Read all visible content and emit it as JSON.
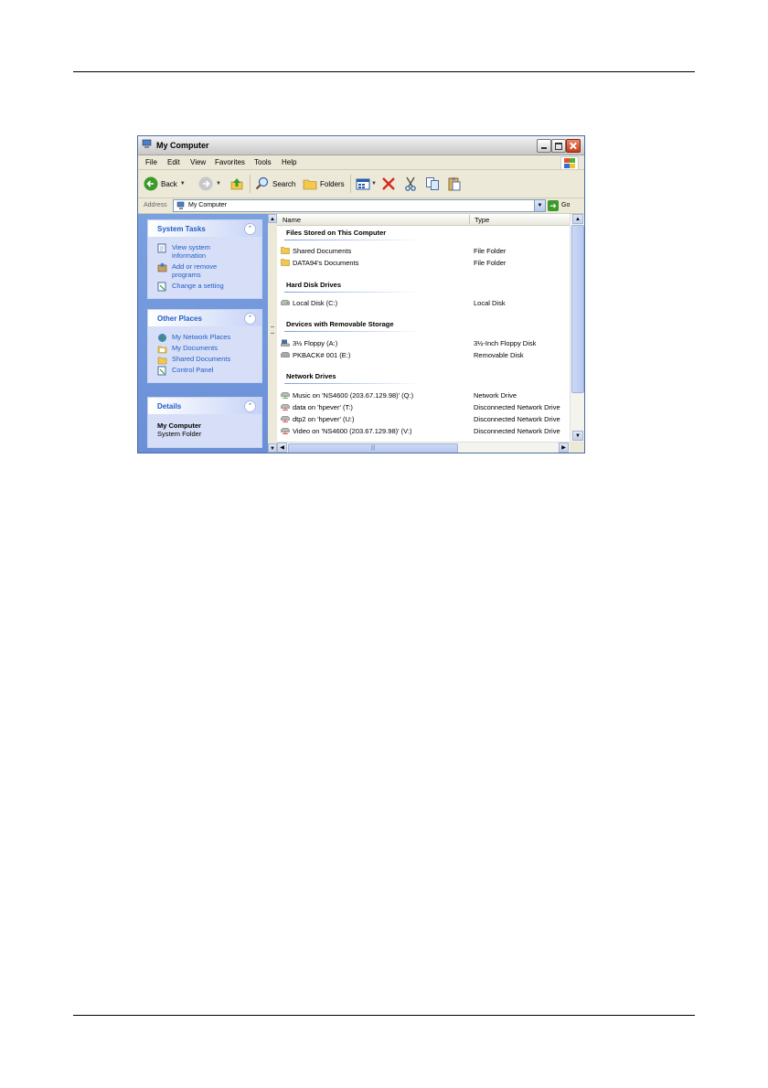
{
  "window": {
    "title": "My Computer",
    "menu": [
      "File",
      "Edit",
      "View",
      "Favorites",
      "Tools",
      "Help"
    ],
    "toolbar": {
      "back_label": "Back",
      "search_label": "Search",
      "folders_label": "Folders"
    },
    "address": {
      "label": "Address",
      "value": "My Computer",
      "go_label": "Go"
    }
  },
  "left_pane": {
    "system_tasks": {
      "title": "System Tasks",
      "items": [
        "View system information",
        "Add or remove programs",
        "Change a setting"
      ]
    },
    "other_places": {
      "title": "Other Places",
      "items": [
        "My Network Places",
        "My Documents",
        "Shared Documents",
        "Control Panel"
      ]
    },
    "details": {
      "title": "Details",
      "name": "My Computer",
      "type": "System Folder"
    }
  },
  "file_list": {
    "columns": {
      "name": "Name",
      "type": "Type"
    },
    "groups": [
      {
        "title": "Files Stored on This Computer",
        "rows": [
          {
            "name": "Shared Documents",
            "type": "File Folder"
          },
          {
            "name": "DATA94's Documents",
            "type": "File Folder"
          }
        ]
      },
      {
        "title": "Hard Disk Drives",
        "rows": [
          {
            "name": "Local Disk (C:)",
            "type": "Local Disk"
          }
        ]
      },
      {
        "title": "Devices with Removable Storage",
        "rows": [
          {
            "name": "3½ Floppy (A:)",
            "type": "3½-Inch Floppy Disk"
          },
          {
            "name": "PKBACK# 001 (E:)",
            "type": "Removable Disk"
          }
        ]
      },
      {
        "title": "Network Drives",
        "rows": [
          {
            "name": "Music on 'NS4600 (203.67.129.98)' (Q:)",
            "type": "Network Drive"
          },
          {
            "name": "data on 'hpever' (T:)",
            "type": "Disconnected Network Drive"
          },
          {
            "name": "dtp2 on 'hpever' (U:)",
            "type": "Disconnected Network Drive"
          },
          {
            "name": "Video on 'NS4600 (203.67.129.98)' (V:)",
            "type": "Disconnected Network Drive"
          }
        ]
      }
    ]
  },
  "colors": {
    "xp_blue": "#215dc6",
    "pane_blue": "#7aa0e0",
    "folder_yellow": "#f2c94c"
  }
}
